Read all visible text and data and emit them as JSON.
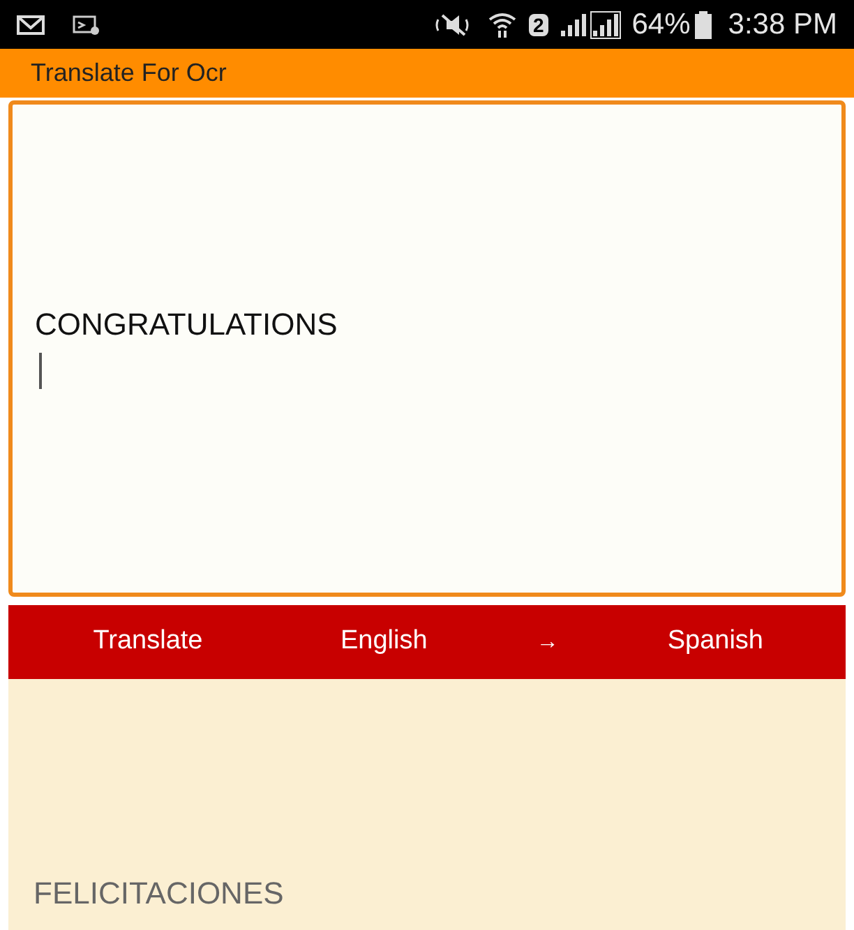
{
  "status_bar": {
    "sim_slot": "2",
    "battery": "64%",
    "time": "3:38 PM"
  },
  "app_bar": {
    "title": "Translate For Ocr"
  },
  "input": {
    "value": "CONGRATULATIONS",
    "focused": true
  },
  "action_bar": {
    "button": "Translate",
    "source_language": "English",
    "arrow": "→",
    "target_language": "Spanish"
  },
  "output": {
    "text": "FELICITACIONES"
  }
}
